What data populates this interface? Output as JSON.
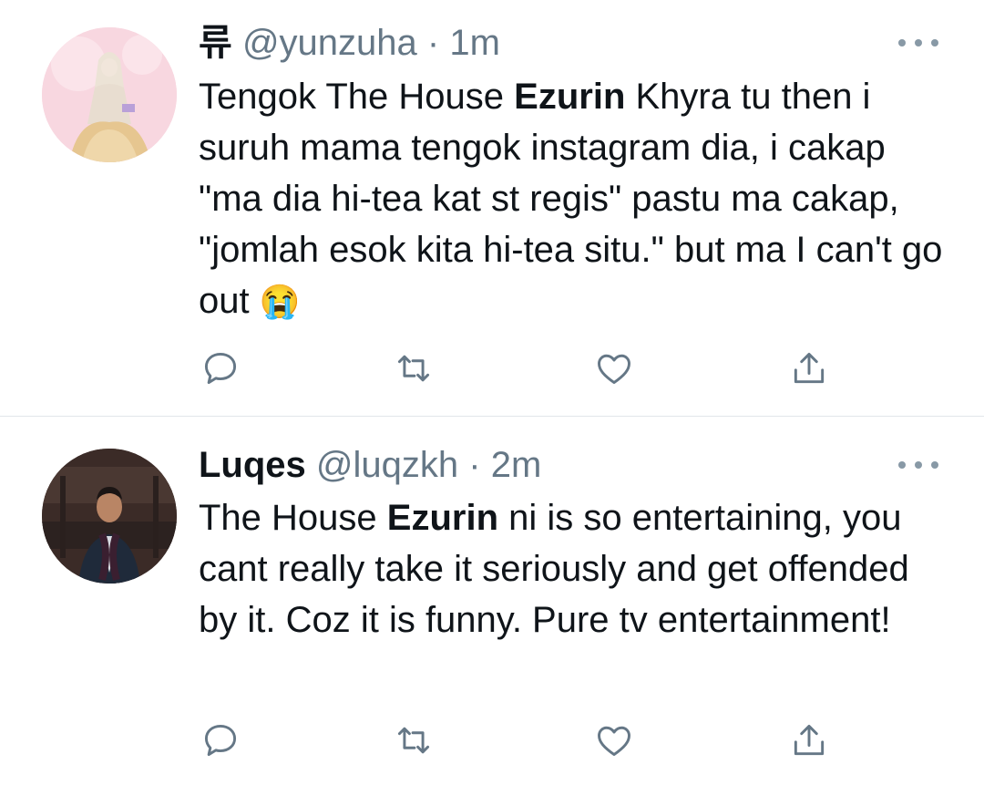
{
  "tweets": [
    {
      "display_name": "류",
      "handle": "@yunzuha",
      "separator": "·",
      "time": "1m",
      "text_parts": [
        {
          "t": "Tengok The House ",
          "bold": false
        },
        {
          "t": "Ezurin",
          "bold": true
        },
        {
          "t": " Khyra tu then i suruh mama tengok instagram dia, i cakap \"ma dia hi-tea kat st regis\" pastu ma cakap, \"jomlah esok kita hi-tea situ.\" but ma I can't go out ",
          "bold": false
        }
      ],
      "emoji": "😭",
      "avatar_icon": "avatar-illustration-icon"
    },
    {
      "display_name": "Luqes",
      "handle": "@luqzkh",
      "separator": "·",
      "time": "2m",
      "text_parts": [
        {
          "t": "The House ",
          "bold": false
        },
        {
          "t": "Ezurin",
          "bold": true
        },
        {
          "t": " ni is so entertaining, you cant really take it seriously and get offended by it. Coz it is funny. Pure tv entertainment!",
          "bold": false
        }
      ],
      "emoji": "",
      "avatar_icon": "avatar-photo-icon"
    }
  ],
  "actions": [
    {
      "name": "reply",
      "icon": "reply-icon"
    },
    {
      "name": "retweet",
      "icon": "retweet-icon"
    },
    {
      "name": "like",
      "icon": "heart-icon"
    },
    {
      "name": "share",
      "icon": "share-icon"
    }
  ],
  "colors": {
    "icon_gray": "#657786",
    "meta_gray": "#657786",
    "divider": "#e1e6ea",
    "text": "#0f1419"
  }
}
